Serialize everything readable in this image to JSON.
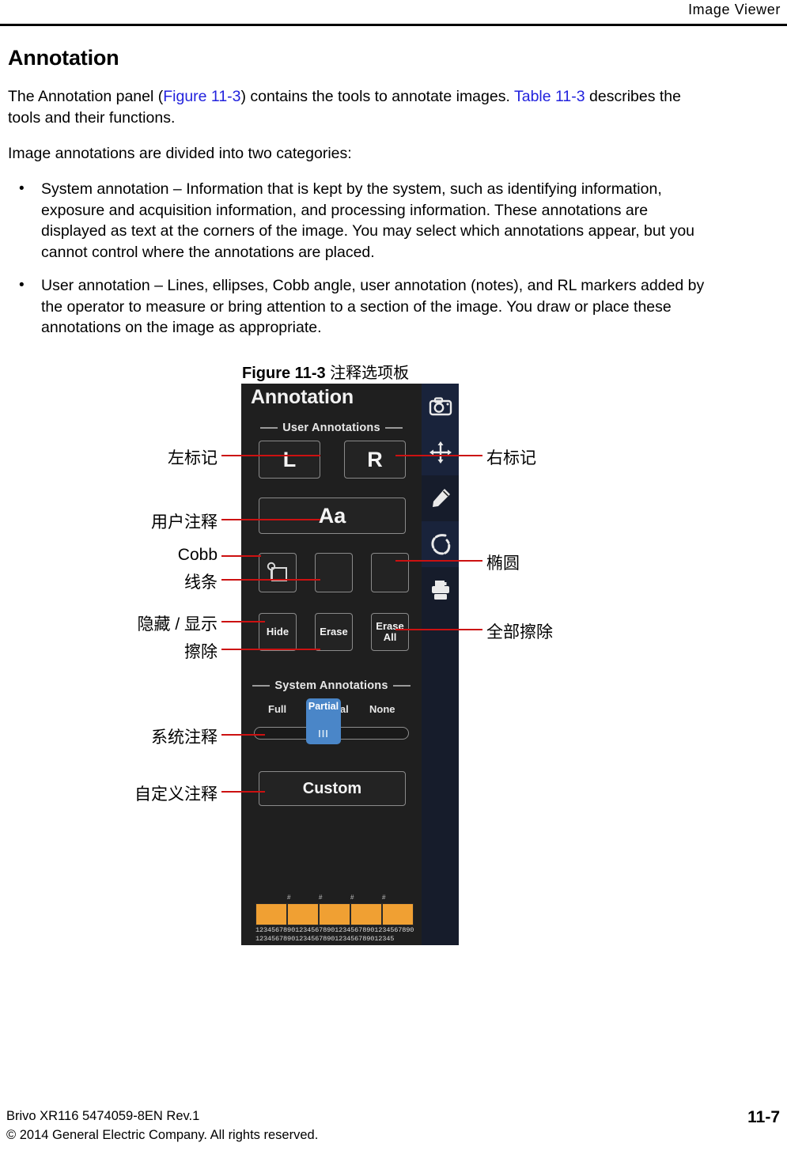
{
  "header": {
    "title": "Image Viewer"
  },
  "content": {
    "section_title": "Annotation",
    "intro_p1_a": "The Annotation panel (",
    "intro_p1_link1": "Figure 11-3",
    "intro_p1_b": ") contains the tools to annotate images. ",
    "intro_p1_link2": "Table 11-3",
    "intro_p1_c": " describes the tools and their functions.",
    "intro_p2": "Image annotations are divided into two categories:",
    "bullets": [
      {
        "marker": "•",
        "text": "System annotation – Information that is kept by the system, such as identifying information, exposure and acquisition information, and processing information. These annotations are displayed as text at the corners of the image. You may select which annotations appear, but you cannot control where the annotations are placed."
      },
      {
        "marker": "•",
        "text": "User annotation – Lines, ellipses, Cobb angle, user annotation (notes), and RL markers added by the operator to measure or bring attention to a section of the image. You draw or place these annotations on the image as appropriate."
      }
    ]
  },
  "figure": {
    "caption_bold": "Figure 11-3",
    "caption_rest": " 注释选项板"
  },
  "panel": {
    "title": "Annotation",
    "user_group_label": "User Annotations",
    "system_group_label": "System Annotations",
    "buttons": {
      "left_marker": "L",
      "right_marker": "R",
      "user_note": "Aa",
      "cobb": "",
      "line": "",
      "ellipse": "",
      "hide": "Hide",
      "erase": "Erase",
      "erase_all_line1": "Erase",
      "erase_all_line2": "All",
      "custom": "Custom"
    },
    "slider": {
      "option_full": "Full",
      "option_partial": "Partial",
      "option_none": "None",
      "selected": "Partial",
      "grip": "III"
    },
    "rail_icons": [
      "camera-icon",
      "move-icon",
      "pencil-icon",
      "lasso-icon",
      "printer-icon"
    ],
    "bottom_strip": {
      "marks": [
        "#",
        "#",
        "#",
        "#"
      ],
      "ruler_line1": "1234567890123456789012345678901234567890",
      "ruler_line2": "12345678901234567890123456789012345"
    },
    "colors": {
      "panel_bg": "#1f1f1f",
      "rail_bg": "#161c2b",
      "rail_bg_alt": "#19233b",
      "button_border": "#8a8a8a",
      "slider_thumb": "#4a86c8",
      "strip_orange": "#f0a033"
    }
  },
  "callouts": {
    "left": [
      {
        "label": "左标记"
      },
      {
        "label": "用户注释"
      },
      {
        "label": "Cobb"
      },
      {
        "label": "线条"
      },
      {
        "label": "隐藏 / 显示"
      },
      {
        "label": "擦除"
      },
      {
        "label": "系统注释"
      },
      {
        "label": "自定义注释"
      }
    ],
    "right": [
      {
        "label": "右标记"
      },
      {
        "label": "椭圆"
      },
      {
        "label": "全部擦除"
      }
    ],
    "leader_color": "#cc1111"
  },
  "footer": {
    "line1": "Brivo XR116 5474059-8EN Rev.1",
    "line2": "© 2014 General Electric Company. All rights reserved.",
    "page_number": "11-7"
  }
}
